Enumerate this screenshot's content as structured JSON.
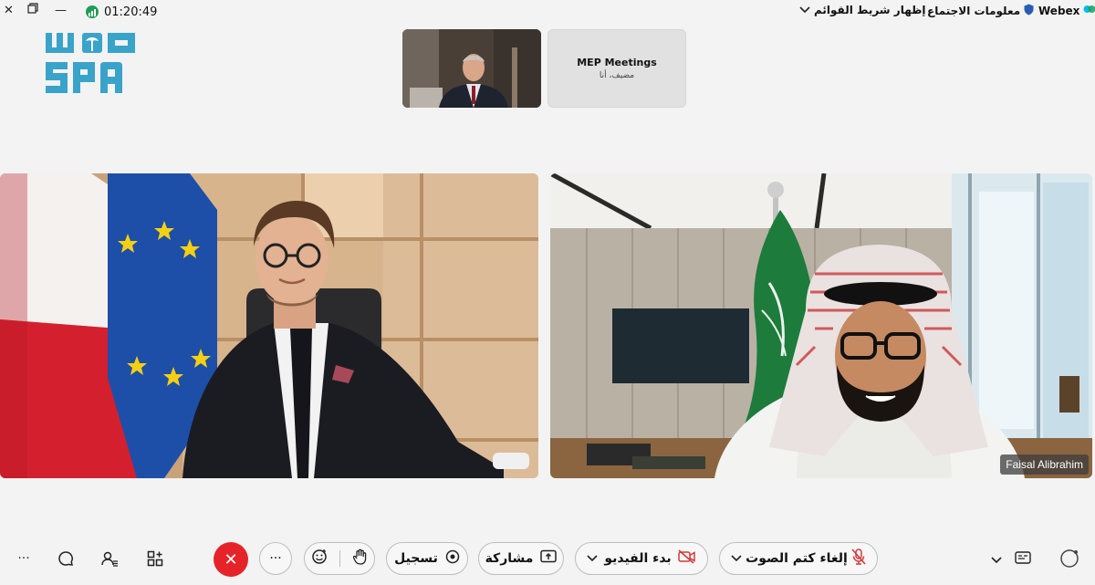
{
  "top_bar": {
    "timer": "01:20:49",
    "app_name": "Webex",
    "meeting_info": "معلومات الاجتماع",
    "show_menu_bar": "إظهار شريط القوائم"
  },
  "logo": {
    "line1": "WAS",
    "line2": "SPA"
  },
  "thumbnails": {
    "host_card_title": "MEP Meetings",
    "host_card_subtitle": "مضيف، أنا"
  },
  "participants": {
    "right_tile_name": "Faisal Alibrahim"
  },
  "controls": {
    "unmute_label": "إلغاء كتم الصوت",
    "start_video_label": "بدء الفيديو",
    "share_label": "مشاركة",
    "record_label": "تسجيل",
    "more_label": "···"
  },
  "colors": {
    "end_call": "#e5242a",
    "logo_blue": "#3aa3c9",
    "saudi_green": "#1d7b3c",
    "timer_green": "#1f9d55"
  }
}
